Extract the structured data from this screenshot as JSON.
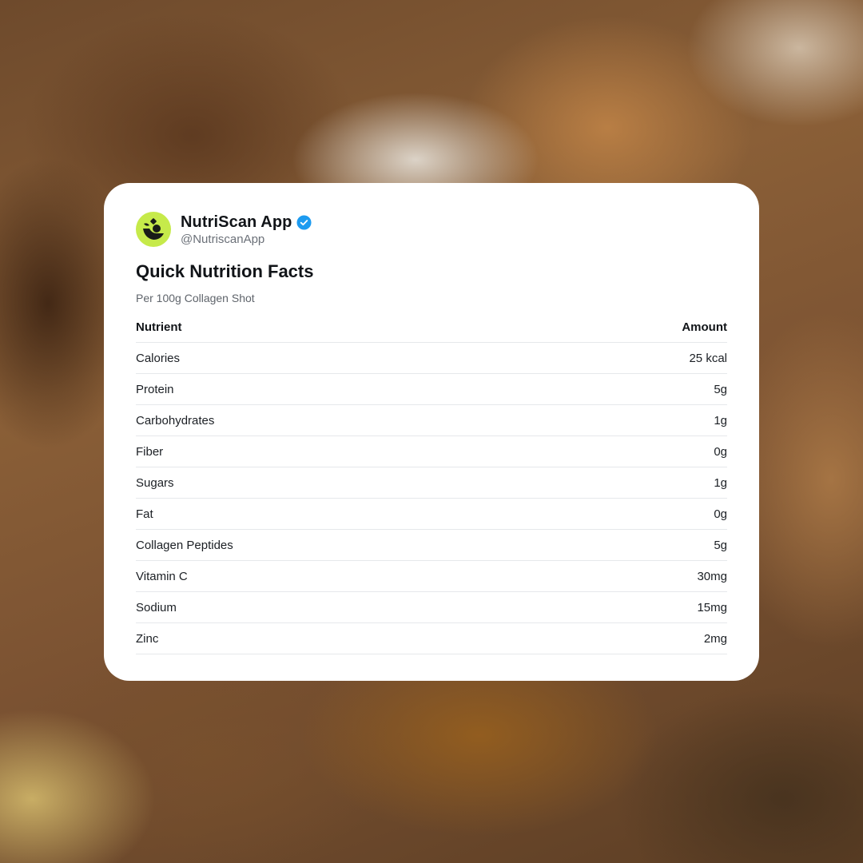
{
  "post": {
    "app_name": "NutriScan App",
    "handle": "@NutriscanApp",
    "avatar_icon": "nutriscan-logo-icon",
    "verified_icon": "verified-badge-icon",
    "colors": {
      "avatar_bg": "#c6ea4a",
      "verified": "#1d9bf0",
      "text": "#111418",
      "muted": "#5f646b"
    }
  },
  "card": {
    "title": "Quick Nutrition Facts",
    "subtitle": "Per 100g Collagen Shot"
  },
  "table": {
    "headers": {
      "nutrient": "Nutrient",
      "amount": "Amount"
    },
    "rows": [
      {
        "nutrient": "Calories",
        "amount": "25 kcal"
      },
      {
        "nutrient": "Protein",
        "amount": "5g"
      },
      {
        "nutrient": "Carbohydrates",
        "amount": "1g"
      },
      {
        "nutrient": "Fiber",
        "amount": "0g"
      },
      {
        "nutrient": "Sugars",
        "amount": "1g"
      },
      {
        "nutrient": "Fat",
        "amount": "0g"
      },
      {
        "nutrient": "Collagen Peptides",
        "amount": "5g"
      },
      {
        "nutrient": "Vitamin C",
        "amount": "30mg"
      },
      {
        "nutrient": "Sodium",
        "amount": "15mg"
      },
      {
        "nutrient": "Zinc",
        "amount": "2mg"
      }
    ]
  }
}
